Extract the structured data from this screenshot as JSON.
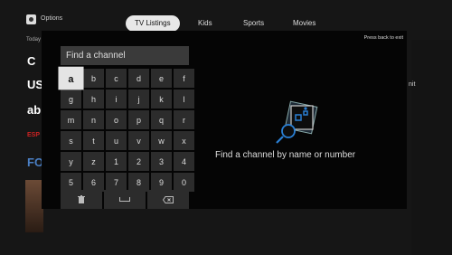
{
  "header": {
    "options_label": "Options",
    "tabs": [
      {
        "label": "TV Listings",
        "active": true
      },
      {
        "label": "Kids",
        "active": false
      },
      {
        "label": "Sports",
        "active": false
      },
      {
        "label": "Movies",
        "active": false
      }
    ],
    "today_label": "Today"
  },
  "channels": [
    {
      "logo": "C"
    },
    {
      "logo": "US"
    },
    {
      "logo": "ab"
    },
    {
      "logo": "ESP"
    },
    {
      "logo": "FO"
    }
  ],
  "right_fragment": "nit",
  "modal": {
    "exit_hint": "Press back to exit",
    "search_placeholder": "Find a channel",
    "keys": [
      [
        "a",
        "b",
        "c",
        "d",
        "e",
        "f"
      ],
      [
        "g",
        "h",
        "i",
        "j",
        "k",
        "l"
      ],
      [
        "m",
        "n",
        "o",
        "p",
        "q",
        "r"
      ],
      [
        "s",
        "t",
        "u",
        "v",
        "w",
        "x"
      ],
      [
        "y",
        "z",
        "1",
        "2",
        "3",
        "4"
      ],
      [
        "5",
        "6",
        "7",
        "8",
        "9",
        "0"
      ]
    ],
    "selected_key": "a",
    "bottom_keys": {
      "delete": "trash-icon",
      "space": "space-icon",
      "backspace": "backspace-icon"
    },
    "message": "Find a channel by name or number"
  },
  "colors": {
    "accent": "#2a7fd4",
    "selected_key": "#e4e4e4"
  }
}
